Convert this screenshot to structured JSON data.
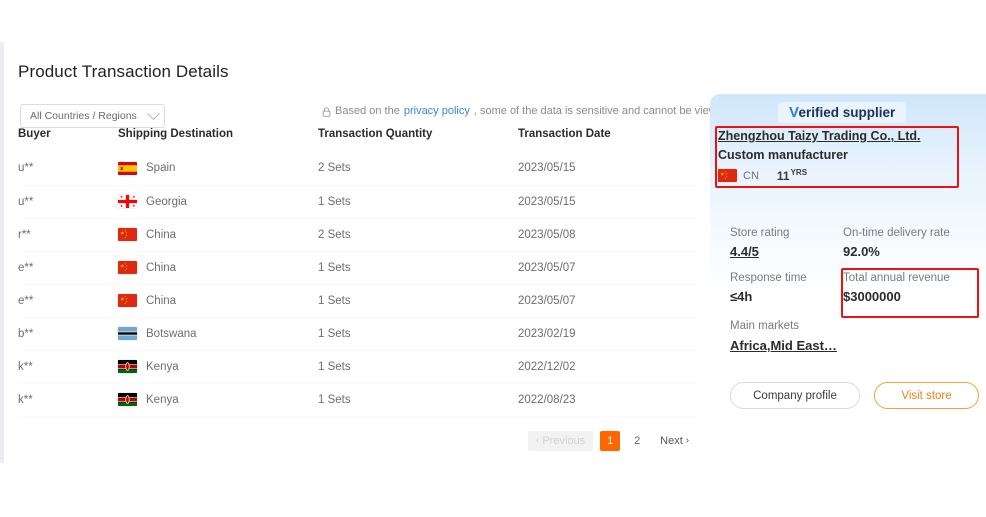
{
  "page": {
    "title": "Product Transaction Details"
  },
  "filter": {
    "selected": "All Countries / Regions",
    "options": [
      "All Countries / Regions"
    ]
  },
  "privacy_note": {
    "prefix": "Based on the",
    "link_text": "privacy policy",
    "suffix": ", some of the data is sensitive and cannot be viewed.",
    "lock_icon": "lock-icon",
    "link_color": "#3b86d6"
  },
  "table": {
    "columns": [
      "Buyer",
      "Shipping Destination",
      "Transaction Quantity",
      "Transaction Date"
    ],
    "rows": [
      {
        "buyer": "u**",
        "destination": "Spain",
        "flag": "flag-es",
        "quantity": "2 Sets",
        "date": "2023/05/15"
      },
      {
        "buyer": "u**",
        "destination": "Georgia",
        "flag": "flag-ge",
        "quantity": "1 Sets",
        "date": "2023/05/15"
      },
      {
        "buyer": "r**",
        "destination": "China",
        "flag": "flag-cn",
        "quantity": "2 Sets",
        "date": "2023/05/08"
      },
      {
        "buyer": "e**",
        "destination": "China",
        "flag": "flag-cn",
        "quantity": "1 Sets",
        "date": "2023/05/07"
      },
      {
        "buyer": "e**",
        "destination": "China",
        "flag": "flag-cn",
        "quantity": "1 Sets",
        "date": "2023/05/07"
      },
      {
        "buyer": "b**",
        "destination": "Botswana",
        "flag": "flag-bw",
        "quantity": "1 Sets",
        "date": "2023/02/19"
      },
      {
        "buyer": "k**",
        "destination": "Kenya",
        "flag": "flag-ke",
        "quantity": "1 Sets",
        "date": "2022/12/02"
      },
      {
        "buyer": "k**",
        "destination": "Kenya",
        "flag": "flag-ke",
        "quantity": "1 Sets",
        "date": "2022/08/23"
      }
    ]
  },
  "pagination": {
    "previous_label": "Previous",
    "previous_disabled": true,
    "pages": [
      "1",
      "2"
    ],
    "current_page": "1",
    "next_label": "Next",
    "active_color": "#ff6600"
  },
  "supplier_card": {
    "badge": {
      "check_glyph": "V",
      "text": "erified supplier"
    },
    "company_name": "Zhengzhou Taizy Trading Co., Ltd.",
    "company_type": "Custom manufacturer",
    "country_code": "CN",
    "country_flag": "flag-cn",
    "years": "11",
    "years_unit": "YRS",
    "stats": [
      {
        "label": "Store rating",
        "value": "4.4/5",
        "underline": true
      },
      {
        "label": "On-time delivery rate",
        "value": "92.0%",
        "underline": false
      },
      {
        "label": "Response time",
        "value": "≤4h",
        "underline": false
      },
      {
        "label": "Total annual revenue",
        "value": "$3000000",
        "underline": false
      }
    ],
    "main_markets": {
      "label": "Main markets",
      "value": "Africa,Mid East…"
    },
    "buttons": {
      "company_profile": "Company profile",
      "visit_store": "Visit store"
    },
    "annotation_color": "#ee1111"
  }
}
